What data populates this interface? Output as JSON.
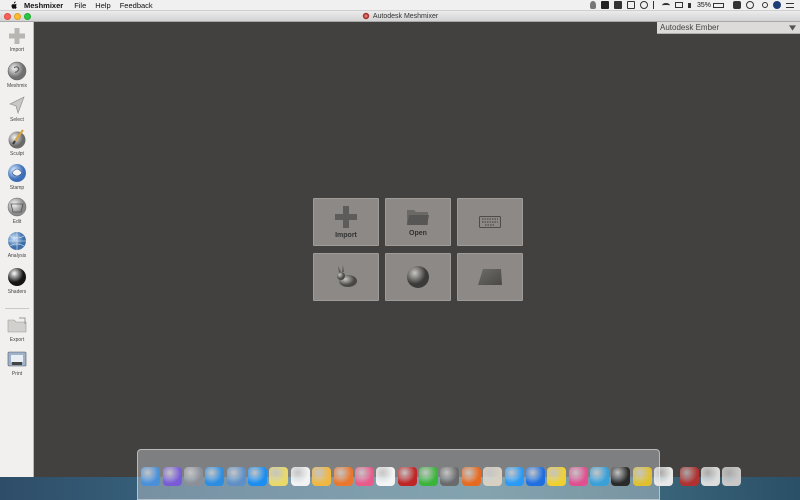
{
  "menubar": {
    "apple_icon": "apple-icon",
    "app_name": "Meshmixer",
    "menus": [
      "File",
      "Help",
      "Feedback"
    ],
    "battery_percent": "35%"
  },
  "window": {
    "title": "Autodesk Meshmixer"
  },
  "toolbar": {
    "items": [
      {
        "label": "Import",
        "icon": "plus-icon"
      },
      {
        "label": "Meshmix",
        "icon": "meshmix-icon"
      },
      {
        "label": "Select",
        "icon": "select-arrow-icon"
      },
      {
        "label": "Sculpt",
        "icon": "sculpt-brush-icon"
      },
      {
        "label": "Stamp",
        "icon": "stamp-icon"
      },
      {
        "label": "Edit",
        "icon": "edit-icon"
      },
      {
        "label": "Analysis",
        "icon": "analysis-sphere-icon"
      },
      {
        "label": "Shaders",
        "icon": "shader-sphere-icon"
      },
      {
        "label": "Export",
        "icon": "export-folder-icon"
      },
      {
        "label": "Print",
        "icon": "printer-icon"
      }
    ]
  },
  "right_panel": {
    "title": "Autodesk Ember"
  },
  "tiles": [
    {
      "label": "Import",
      "icon": "plus-icon"
    },
    {
      "label": "Open",
      "icon": "folder-icon"
    },
    {
      "label": "",
      "icon": "keyboard-icon"
    },
    {
      "label": "",
      "icon": "bunny-icon"
    },
    {
      "label": "",
      "icon": "sphere-icon"
    },
    {
      "label": "",
      "icon": "plane-icon"
    }
  ],
  "dock": {
    "apps": [
      {
        "icon": "finder-icon",
        "color": "#4a90d9"
      },
      {
        "icon": "siri-icon",
        "color": "#7a5bd6"
      },
      {
        "icon": "launchpad-icon",
        "color": "#8a8f98"
      },
      {
        "icon": "safari-icon",
        "color": "#2d8de0"
      },
      {
        "icon": "preview-icon",
        "color": "#5e8fc7"
      },
      {
        "icon": "app-store-icon",
        "color": "#1b8ef0"
      },
      {
        "icon": "game-center-icon",
        "color": "#e9d96b"
      },
      {
        "icon": "calendar-icon",
        "color": "#f2f2f2"
      },
      {
        "icon": "package-icon",
        "color": "#f0b742"
      },
      {
        "icon": "basketball-icon",
        "color": "#e9772e"
      },
      {
        "icon": "itunes-icon",
        "color": "#e85b8b"
      },
      {
        "icon": "photos-icon",
        "color": "#f4f4f4"
      },
      {
        "icon": "tv-icon",
        "color": "#c02525"
      },
      {
        "icon": "iqiyi-icon",
        "color": "#3cb43c"
      },
      {
        "icon": "time-machine-icon",
        "color": "#6a6a6a"
      },
      {
        "icon": "firefox-icon",
        "color": "#e66a20"
      },
      {
        "icon": "game-icon",
        "color": "#d8d0c0"
      },
      {
        "icon": "qq-icon",
        "color": "#2a9af5"
      },
      {
        "icon": "kugou-icon",
        "color": "#1f6fe0"
      },
      {
        "icon": "yellow-app-icon",
        "color": "#f0d030"
      },
      {
        "icon": "pinwheel-icon",
        "color": "#e05090"
      },
      {
        "icon": "map-icon",
        "color": "#3aa0d8"
      },
      {
        "icon": "screen-icon",
        "color": "#2a2a2a"
      },
      {
        "icon": "chrome-icon",
        "color": "#e0c030"
      },
      {
        "icon": "text-editor-icon",
        "color": "#e8e8e8"
      },
      {
        "icon": "meshmixer-icon",
        "color": "#b0312f"
      },
      {
        "icon": "finder-window-icon",
        "color": "#dcdcdc"
      },
      {
        "icon": "trash-icon",
        "color": "#c8c8c8"
      }
    ]
  },
  "colors": {
    "viewport_bg": "#42413f",
    "tile_bg": "#8c8986",
    "toolbar_bg": "#f1f0ee"
  }
}
